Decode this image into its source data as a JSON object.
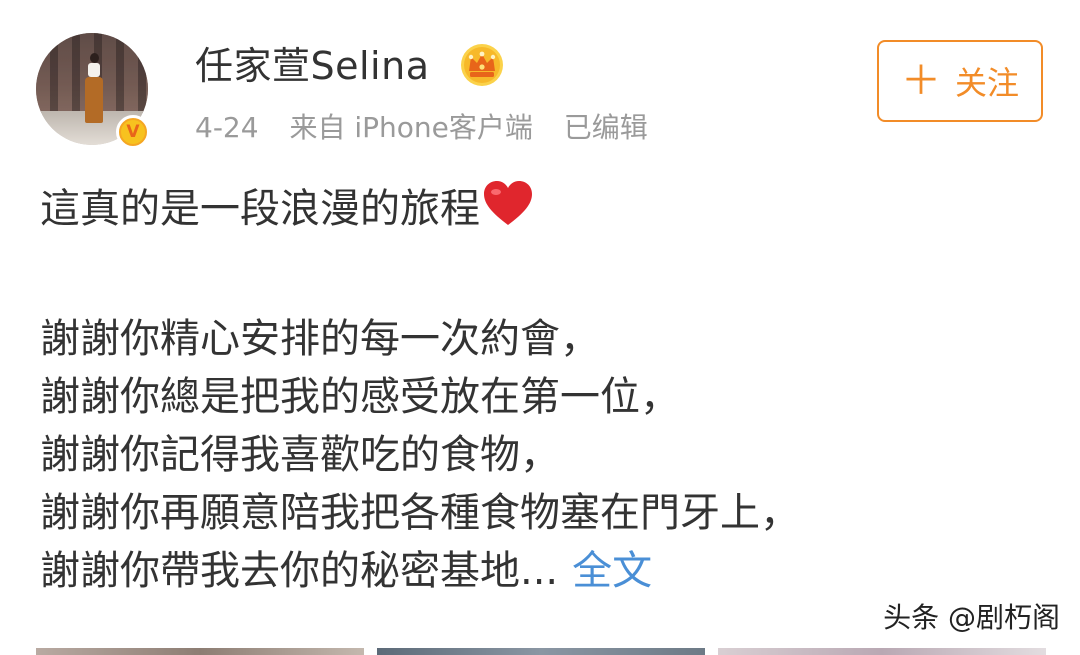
{
  "header": {
    "username": "任家萱Selina",
    "badge_icon": "crown-icon",
    "verified_icon": "v-verified-icon",
    "verified_letter": "V",
    "date": "4-24",
    "source": "来自 iPhone客户端",
    "edited": "已编辑",
    "follow_label": "关注",
    "follow_plus": "＋",
    "accent_color": "#f28c28"
  },
  "post": {
    "lines": [
      "這真的是一段浪漫的旅程",
      "謝謝你精心安排的每一次約會，",
      "謝謝你總是把我的感受放在第一位，",
      "謝謝你記得我喜歡吃的食物，",
      "謝謝你再願意陪我把各種食物塞在門牙上，",
      "謝謝你帶我去你的秘密基地..."
    ],
    "heart_icon": "red-heart-icon",
    "full_text_link": "全文",
    "link_color": "#4a8fd6"
  },
  "watermark": {
    "text": "头条 @剧朽阁"
  }
}
